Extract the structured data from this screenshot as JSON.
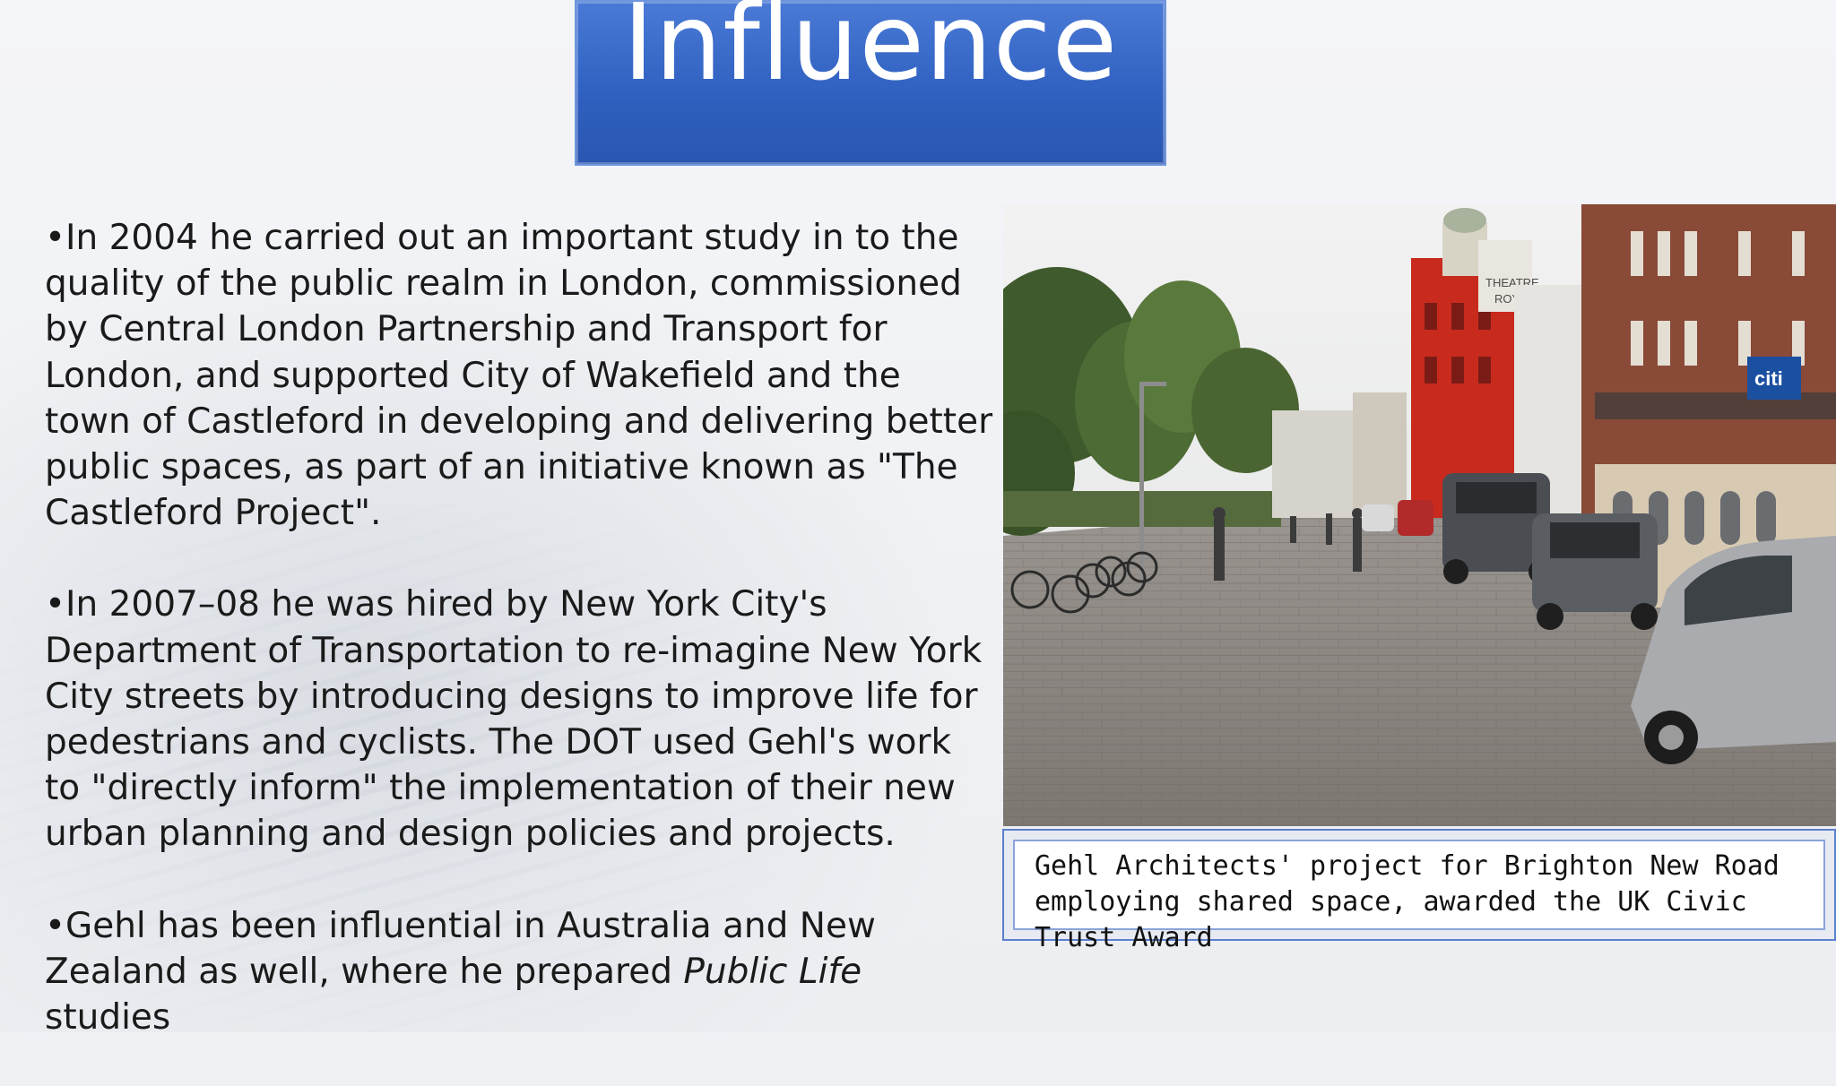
{
  "slide": {
    "title": "Influence",
    "paragraphs": [
      {
        "text": "•In 2004 he carried out an important study in to the quality of the public realm in London, commissioned by Central London Partnership and Transport for London, and supported City of Wakefield and the town of Castleford in developing and delivering better public spaces, as part of an initiative known as \"The Castleford Project\"."
      },
      {
        "text": "•In 2007–08 he was hired by New York City's Department of Transportation to re-imagine New York City streets by introducing designs to improve life for pedestrians and cyclists. The DOT used Gehl's work to \"directly inform\" the implementation of their new urban planning and design policies and projects."
      },
      {
        "text_before": "•Gehl has been influential in Australia and New Zealand as well, where he prepared ",
        "text_italic": "Public Life",
        "text_after": " studies"
      }
    ],
    "photo": {
      "signs": {
        "theatre": "THEATRE ROYAL",
        "bank": "citi"
      }
    },
    "caption": "Gehl Architects' project for Brighton New Road employing shared space, awarded the UK Civic Trust Award"
  },
  "colors": {
    "title_bg": "#2f5fbf",
    "caption_border": "#5b7fcf",
    "theatre_red": "#c92a1e"
  }
}
